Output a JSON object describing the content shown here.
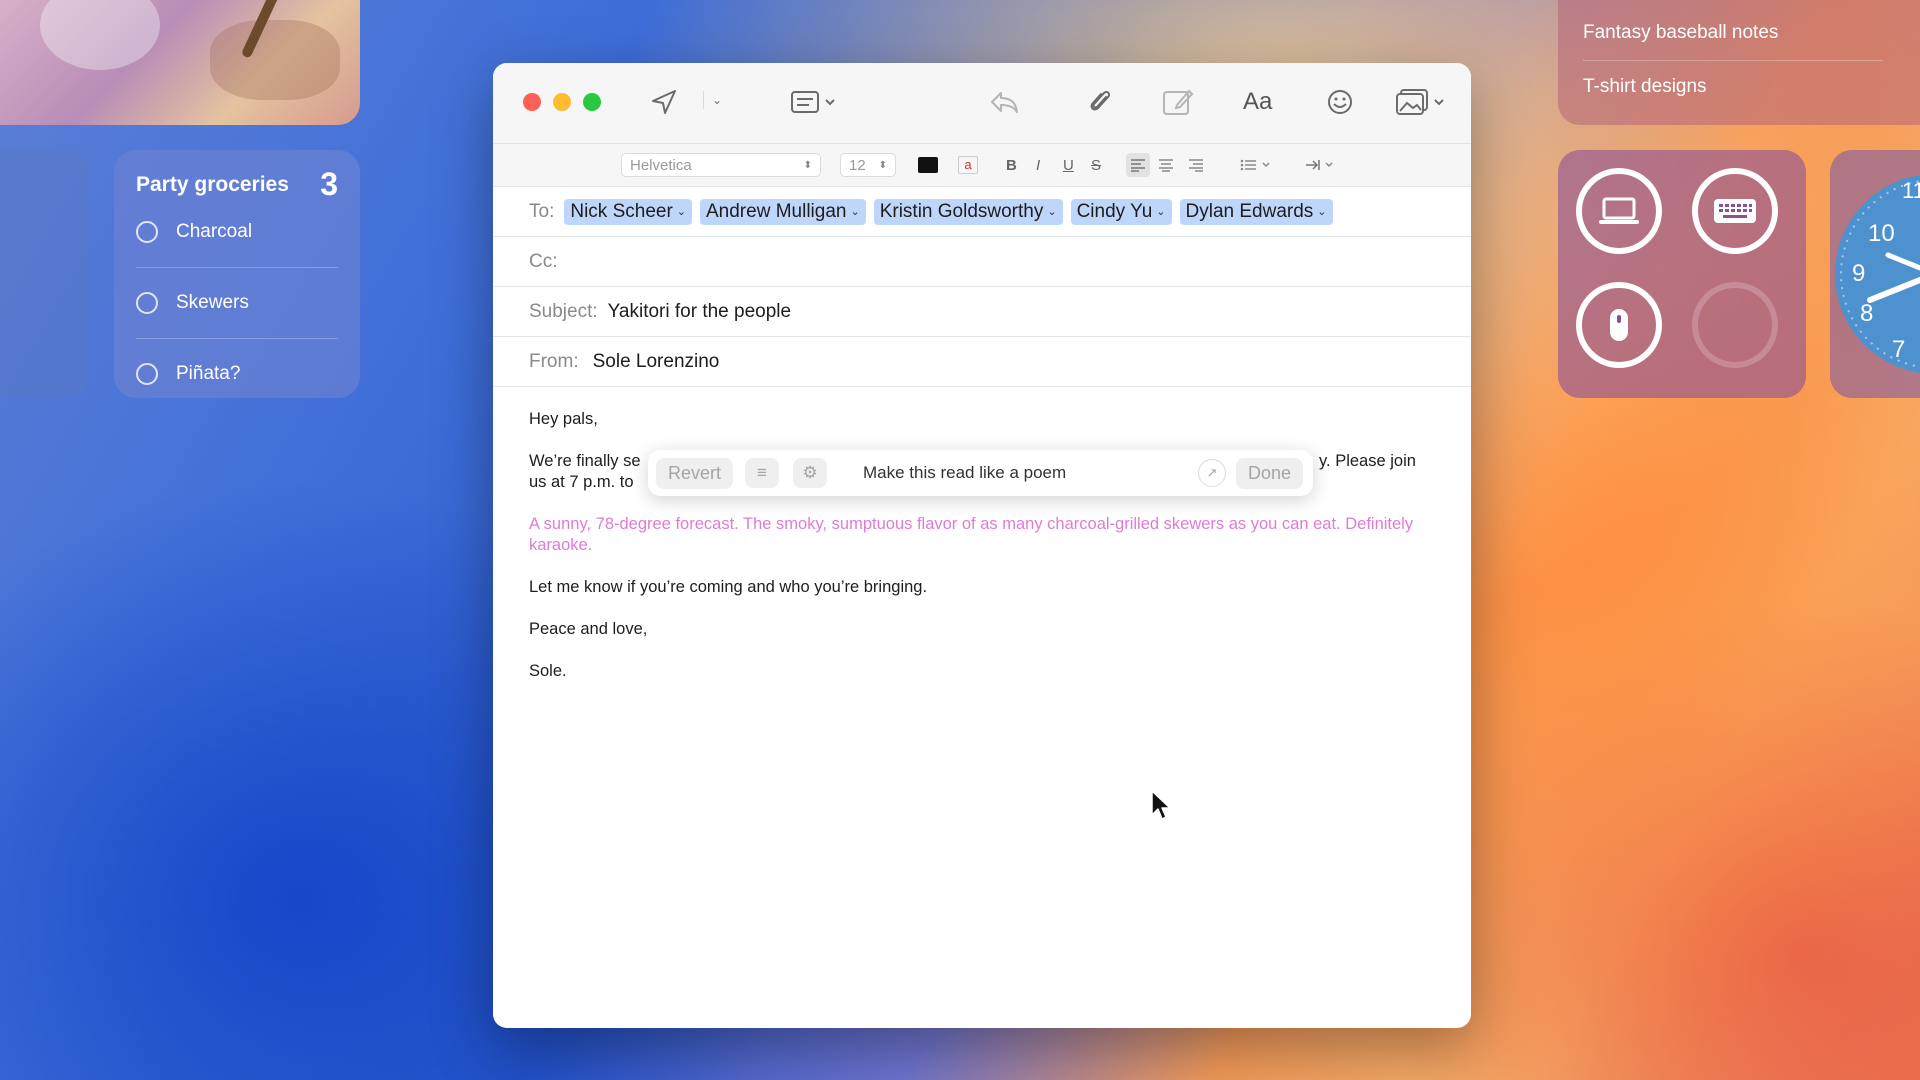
{
  "widgets": {
    "groceries": {
      "title": "Party groceries",
      "count": "3",
      "items": [
        "Charcoal",
        "Skewers",
        "Piñata?"
      ]
    },
    "notes": {
      "items": [
        "Fantasy baseball notes",
        "T-shirt designs"
      ]
    },
    "clock": {
      "numbers": [
        "11",
        "10",
        "9",
        "8",
        "7"
      ]
    }
  },
  "mail": {
    "toolbar": {
      "icons": [
        "send-icon",
        "chevron-down-icon",
        "header-fields-icon",
        "reply-icon",
        "attachment-icon",
        "markup-icon",
        "font-icon",
        "emoji-icon",
        "photo-browser-icon"
      ],
      "font_icon_label": "Aa"
    },
    "format": {
      "font": "Helvetica",
      "size": "12",
      "bold": "B",
      "italic": "I",
      "underline": "U",
      "strike": "S"
    },
    "to_label": "To:",
    "recipients": [
      "Nick Scheer",
      "Andrew Mulligan",
      "Kristin Goldsworthy",
      "Cindy Yu",
      "Dylan Edwards"
    ],
    "cc_label": "Cc:",
    "subject_label": "Subject:",
    "subject": "Yakitori for the people",
    "from_label": "From:",
    "from": "Sole Lorenzino",
    "body": {
      "greeting": "Hey pals,",
      "para1_start": "We’re finally se",
      "para1_end": "y. Please join",
      "para1_line2": "us at 7 p.m. to",
      "rewritten": "A sunny, 78-degree forecast. The smoky, sumptuous flavor of as many charcoal-grilled skewers as you can eat. Definitely karaoke.",
      "para3": "Let me know if you’re coming and who you’re bringing.",
      "signoff": "Peace and love,",
      "name": "Sole."
    },
    "rewrite_bar": {
      "revert": "Revert",
      "prompt": "Make this read like a poem",
      "done": "Done"
    }
  },
  "colors": {
    "close": "#ff5f57",
    "minimize": "#febc2e",
    "zoom": "#28c840",
    "chip": "#bfd6fb",
    "ai_text": "#e07bd4"
  }
}
